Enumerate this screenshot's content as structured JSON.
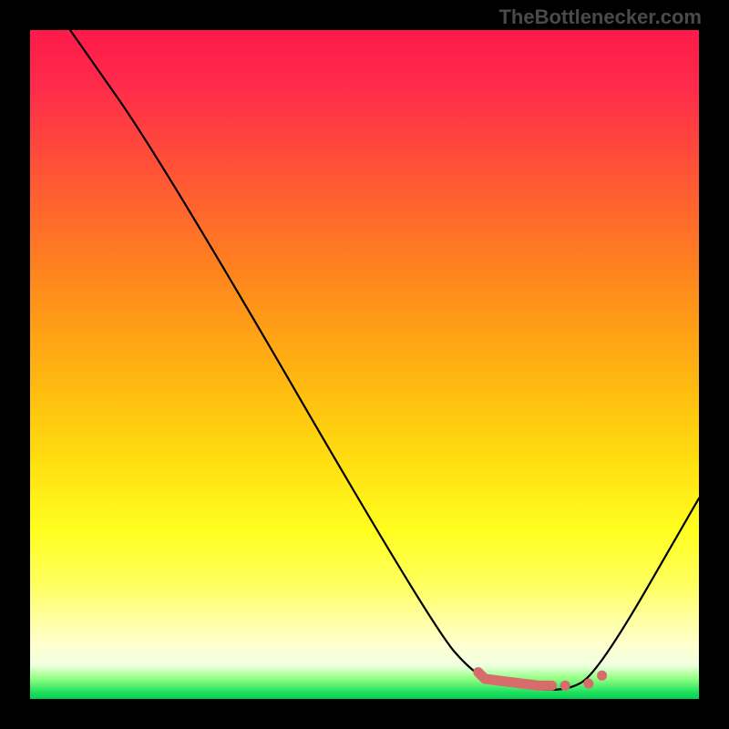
{
  "attribution": "TheBottlenecker.com",
  "chart_data": {
    "type": "line",
    "title": "",
    "xlabel": "",
    "ylabel": "",
    "x_range": [
      0,
      100
    ],
    "y_range": [
      0,
      100
    ],
    "description": "Bottleneck percentage curve over a red-to-green gradient; low values (green, near bottom) indicate good match, high values (red, top) indicate severe bottleneck. Minimum (optimal point) occurs near x≈80.",
    "main_curve": [
      {
        "x": 6,
        "y": 100
      },
      {
        "x": 20,
        "y": 80
      },
      {
        "x": 60,
        "y": 11
      },
      {
        "x": 67,
        "y": 3
      },
      {
        "x": 72,
        "y": 2
      },
      {
        "x": 80,
        "y": 1
      },
      {
        "x": 85,
        "y": 4
      },
      {
        "x": 100,
        "y": 30
      }
    ],
    "highlight_segment": {
      "color": "#d86b6b",
      "points": [
        {
          "x": 67,
          "y": 4
        },
        {
          "x": 68,
          "y": 3
        },
        {
          "x": 72,
          "y": 2.5
        },
        {
          "x": 76,
          "y": 2
        },
        {
          "x": 78,
          "y": 2
        }
      ],
      "extra_dots": [
        {
          "x": 80,
          "y": 2
        },
        {
          "x": 83.5,
          "y": 2.3
        },
        {
          "x": 85.5,
          "y": 3.5
        }
      ]
    },
    "gradient_stops": [
      {
        "pos": 0,
        "color": "#ff1a4a"
      },
      {
        "pos": 50,
        "color": "#ffc010"
      },
      {
        "pos": 95,
        "color": "#ffffd0"
      },
      {
        "pos": 100,
        "color": "#00d050"
      }
    ]
  }
}
